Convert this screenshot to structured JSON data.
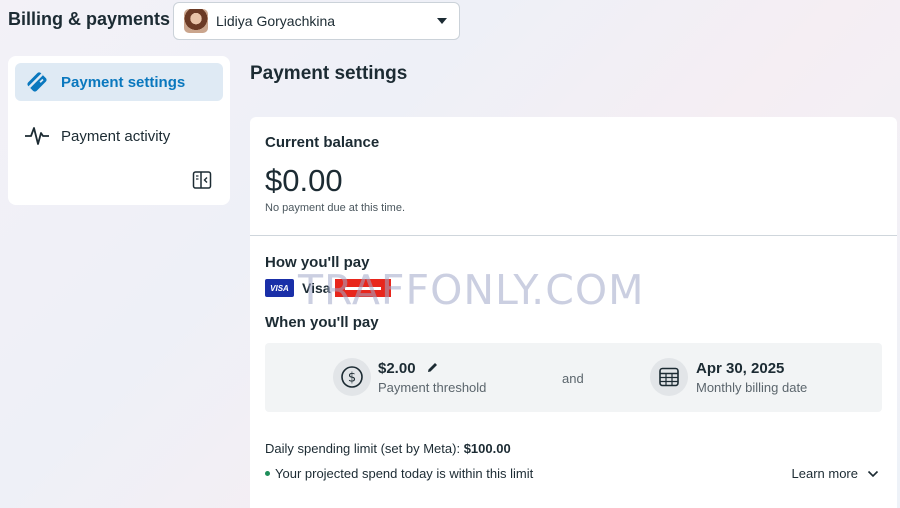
{
  "header": {
    "title": "Billing & payments",
    "account_name": "Lidiya Goryachkina"
  },
  "sidebar": {
    "items": [
      {
        "label": "Payment settings",
        "icon": "card-icon",
        "active": true
      },
      {
        "label": "Payment activity",
        "icon": "activity-icon",
        "active": false
      }
    ]
  },
  "main": {
    "title": "Payment settings",
    "balance": {
      "heading": "Current balance",
      "amount": "$0.00",
      "note": "No payment due at this time."
    },
    "payment_method": {
      "heading": "How you'll pay",
      "badge": "VISA",
      "label": "Visa"
    },
    "watermark": "TRAFFONLY.COM",
    "schedule": {
      "heading": "When you'll pay",
      "threshold_value": "$2.00",
      "threshold_label": "Payment threshold",
      "connector": "and",
      "date_value": "Apr 30, 2025",
      "date_label": "Monthly billing date"
    },
    "limit": {
      "label": "Daily spending limit (set by Meta): ",
      "value": "$100.00",
      "status": "Your projected spend today is within this limit",
      "learn_more": "Learn more"
    }
  },
  "colors": {
    "accent": "#0a78be",
    "active_bg": "#dfeaf4",
    "status_green": "#1e8e5a",
    "visa_blue": "#1a2fa8"
  }
}
